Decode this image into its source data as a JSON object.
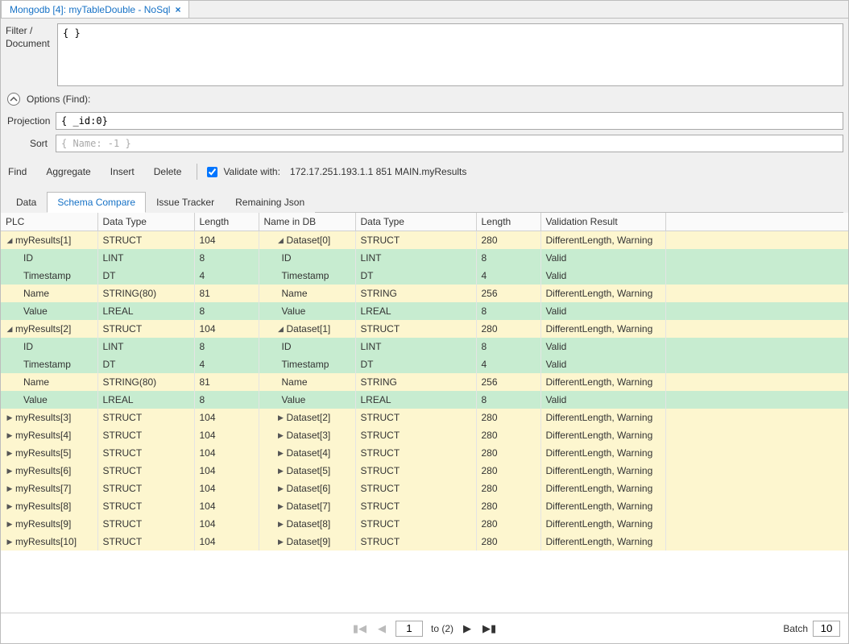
{
  "tab": {
    "title": "Mongodb [4]: myTableDouble - NoSql"
  },
  "filter": {
    "label": "Filter / Document",
    "value": "{ }"
  },
  "options_header": "Options (Find):",
  "projection": {
    "label": "Projection",
    "value": "{ _id:0}"
  },
  "sort": {
    "label": "Sort",
    "placeholder": "{ Name: -1 }"
  },
  "toolbar": {
    "find": "Find",
    "aggregate": "Aggregate",
    "insert": "Insert",
    "delete": "Delete",
    "validate_label": "Validate with:",
    "validate_target": "172.17.251.193.1.1  851  MAIN.myResults"
  },
  "subtabs": {
    "data": "Data",
    "schema_compare": "Schema Compare",
    "issue_tracker": "Issue Tracker",
    "remaining_json": "Remaining Json"
  },
  "headers": {
    "plc": "PLC",
    "dt1": "Data Type",
    "len1": "Length",
    "name_db": "Name in DB",
    "dt2": "Data Type",
    "len2": "Length",
    "vr": "Validation Result"
  },
  "rows": [
    {
      "expand": "down",
      "indent": 0,
      "plc": "myResults[1]",
      "dt1": "STRUCT",
      "len1": "104",
      "db_expand": "down",
      "db_indent": 0,
      "name_db": "Dataset[0]",
      "dt2": "STRUCT",
      "len2": "280",
      "vr": "DifferentLength, Warning",
      "status": "warn"
    },
    {
      "expand": "",
      "indent": 1,
      "plc": "ID",
      "dt1": "LINT",
      "len1": "8",
      "db_expand": "",
      "db_indent": 1,
      "name_db": "ID",
      "dt2": "LINT",
      "len2": "8",
      "vr": "Valid",
      "status": "valid"
    },
    {
      "expand": "",
      "indent": 1,
      "plc": "Timestamp",
      "dt1": "DT",
      "len1": "4",
      "db_expand": "",
      "db_indent": 1,
      "name_db": "Timestamp",
      "dt2": "DT",
      "len2": "4",
      "vr": "Valid",
      "status": "valid"
    },
    {
      "expand": "",
      "indent": 1,
      "plc": "Name",
      "dt1": "STRING(80)",
      "len1": "81",
      "db_expand": "",
      "db_indent": 1,
      "name_db": "Name",
      "dt2": "STRING",
      "len2": "256",
      "vr": "DifferentLength, Warning",
      "status": "warn"
    },
    {
      "expand": "",
      "indent": 1,
      "plc": "Value",
      "dt1": "LREAL",
      "len1": "8",
      "db_expand": "",
      "db_indent": 1,
      "name_db": "Value",
      "dt2": "LREAL",
      "len2": "8",
      "vr": "Valid",
      "status": "valid"
    },
    {
      "expand": "down",
      "indent": 0,
      "plc": "myResults[2]",
      "dt1": "STRUCT",
      "len1": "104",
      "db_expand": "down",
      "db_indent": 0,
      "name_db": "Dataset[1]",
      "dt2": "STRUCT",
      "len2": "280",
      "vr": "DifferentLength, Warning",
      "status": "warn"
    },
    {
      "expand": "",
      "indent": 1,
      "plc": "ID",
      "dt1": "LINT",
      "len1": "8",
      "db_expand": "",
      "db_indent": 1,
      "name_db": "ID",
      "dt2": "LINT",
      "len2": "8",
      "vr": "Valid",
      "status": "valid"
    },
    {
      "expand": "",
      "indent": 1,
      "plc": "Timestamp",
      "dt1": "DT",
      "len1": "4",
      "db_expand": "",
      "db_indent": 1,
      "name_db": "Timestamp",
      "dt2": "DT",
      "len2": "4",
      "vr": "Valid",
      "status": "valid"
    },
    {
      "expand": "",
      "indent": 1,
      "plc": "Name",
      "dt1": "STRING(80)",
      "len1": "81",
      "db_expand": "",
      "db_indent": 1,
      "name_db": "Name",
      "dt2": "STRING",
      "len2": "256",
      "vr": "DifferentLength, Warning",
      "status": "warn"
    },
    {
      "expand": "",
      "indent": 1,
      "plc": "Value",
      "dt1": "LREAL",
      "len1": "8",
      "db_expand": "",
      "db_indent": 1,
      "name_db": "Value",
      "dt2": "LREAL",
      "len2": "8",
      "vr": "Valid",
      "status": "valid"
    },
    {
      "expand": "right",
      "indent": 0,
      "plc": "myResults[3]",
      "dt1": "STRUCT",
      "len1": "104",
      "db_expand": "right",
      "db_indent": 0,
      "name_db": "Dataset[2]",
      "dt2": "STRUCT",
      "len2": "280",
      "vr": "DifferentLength, Warning",
      "status": "warn"
    },
    {
      "expand": "right",
      "indent": 0,
      "plc": "myResults[4]",
      "dt1": "STRUCT",
      "len1": "104",
      "db_expand": "right",
      "db_indent": 0,
      "name_db": "Dataset[3]",
      "dt2": "STRUCT",
      "len2": "280",
      "vr": "DifferentLength, Warning",
      "status": "warn"
    },
    {
      "expand": "right",
      "indent": 0,
      "plc": "myResults[5]",
      "dt1": "STRUCT",
      "len1": "104",
      "db_expand": "right",
      "db_indent": 0,
      "name_db": "Dataset[4]",
      "dt2": "STRUCT",
      "len2": "280",
      "vr": "DifferentLength, Warning",
      "status": "warn"
    },
    {
      "expand": "right",
      "indent": 0,
      "plc": "myResults[6]",
      "dt1": "STRUCT",
      "len1": "104",
      "db_expand": "right",
      "db_indent": 0,
      "name_db": "Dataset[5]",
      "dt2": "STRUCT",
      "len2": "280",
      "vr": "DifferentLength, Warning",
      "status": "warn"
    },
    {
      "expand": "right",
      "indent": 0,
      "plc": "myResults[7]",
      "dt1": "STRUCT",
      "len1": "104",
      "db_expand": "right",
      "db_indent": 0,
      "name_db": "Dataset[6]",
      "dt2": "STRUCT",
      "len2": "280",
      "vr": "DifferentLength, Warning",
      "status": "warn"
    },
    {
      "expand": "right",
      "indent": 0,
      "plc": "myResults[8]",
      "dt1": "STRUCT",
      "len1": "104",
      "db_expand": "right",
      "db_indent": 0,
      "name_db": "Dataset[7]",
      "dt2": "STRUCT",
      "len2": "280",
      "vr": "DifferentLength, Warning",
      "status": "warn"
    },
    {
      "expand": "right",
      "indent": 0,
      "plc": "myResults[9]",
      "dt1": "STRUCT",
      "len1": "104",
      "db_expand": "right",
      "db_indent": 0,
      "name_db": "Dataset[8]",
      "dt2": "STRUCT",
      "len2": "280",
      "vr": "DifferentLength, Warning",
      "status": "warn"
    },
    {
      "expand": "right",
      "indent": 0,
      "plc": "myResults[10]",
      "dt1": "STRUCT",
      "len1": "104",
      "db_expand": "right",
      "db_indent": 0,
      "name_db": "Dataset[9]",
      "dt2": "STRUCT",
      "len2": "280",
      "vr": "DifferentLength, Warning",
      "status": "warn"
    }
  ],
  "pager": {
    "page": "1",
    "to_label": "to (2)"
  },
  "batch": {
    "label": "Batch",
    "value": "10"
  }
}
